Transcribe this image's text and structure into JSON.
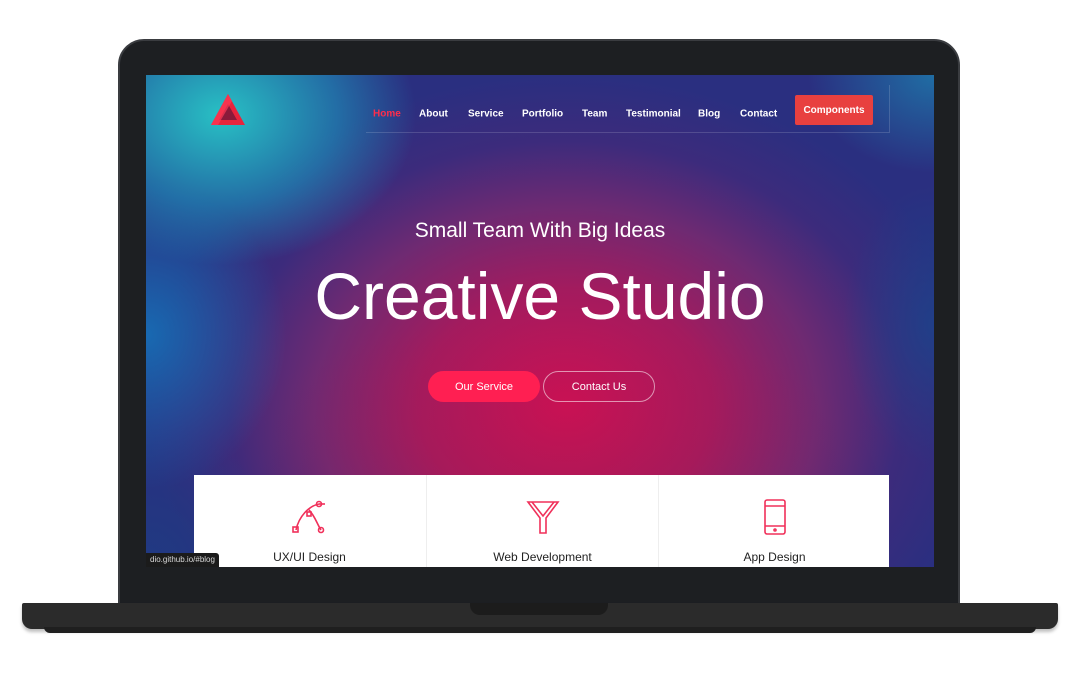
{
  "nav": {
    "items": [
      {
        "label": "Home",
        "active": true
      },
      {
        "label": "About"
      },
      {
        "label": "Service"
      },
      {
        "label": "Portfolio"
      },
      {
        "label": "Team"
      },
      {
        "label": "Testimonial"
      },
      {
        "label": "Blog"
      },
      {
        "label": "Contact"
      }
    ],
    "cta": "Components"
  },
  "logo": {
    "icon": "triangle-logo-icon",
    "color": "#e8243c"
  },
  "hero": {
    "subtitle": "Small Team With Big Ideas",
    "title": "Creative Studio",
    "primary_button": "Our Service",
    "secondary_button": "Contact Us"
  },
  "services": [
    {
      "label": "UX/UI Design",
      "icon": "bezier-curve-icon"
    },
    {
      "label": "Web Development",
      "icon": "funnel-icon"
    },
    {
      "label": "App Design",
      "icon": "mobile-phone-icon"
    }
  ],
  "status_url": "dio.github.io/#blog",
  "colors": {
    "accent": "#ff1f52",
    "cta": "#e8403f",
    "active_nav": "#ff2d4b",
    "icon": "#f0305a"
  }
}
